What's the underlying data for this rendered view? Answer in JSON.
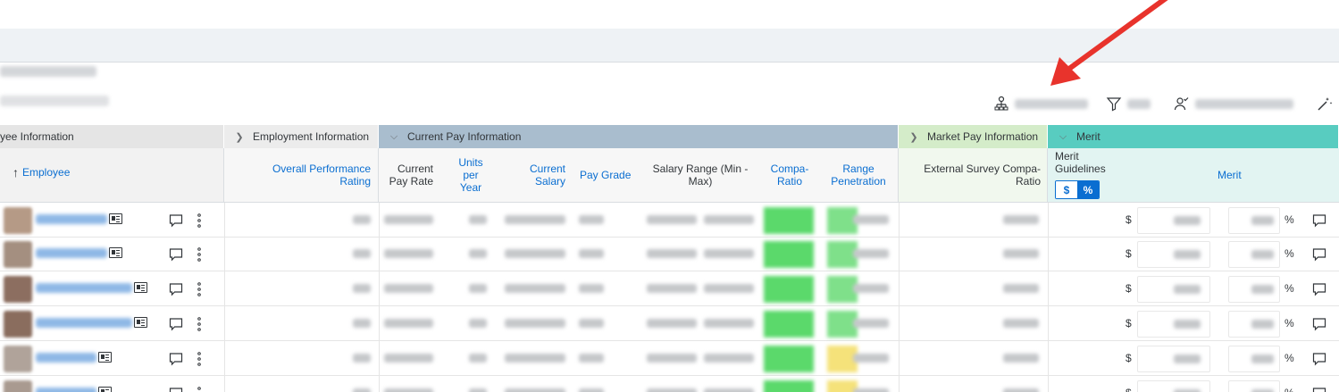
{
  "toolbar": {
    "items": [
      {
        "icon": "hierarchy-icon"
      },
      {
        "icon": "filter-icon"
      },
      {
        "icon": "user-check-icon"
      },
      {
        "icon": "magic-wand-icon"
      }
    ]
  },
  "groups": {
    "employee": "yee Information",
    "employment": "Employment Information",
    "current_pay": "Current Pay Information",
    "market_pay": "Market Pay Information",
    "merit": "Merit"
  },
  "columns": {
    "employee": "Employee",
    "overall_rating_1": "Overall Performance",
    "overall_rating_2": "Rating",
    "current_pay_rate_1": "Current",
    "current_pay_rate_2": "Pay Rate",
    "units_per_year_1": "Units",
    "units_per_year_2": "per",
    "units_per_year_3": "Year",
    "current_salary_1": "Current",
    "current_salary_2": "Salary",
    "pay_grade": "Pay Grade",
    "salary_range_1": "Salary Range (Min -",
    "salary_range_2": "Max)",
    "compa_ratio_1": "Compa-",
    "compa_ratio_2": "Ratio",
    "range_penetration_1": "Range",
    "range_penetration_2": "Penetration",
    "ext_survey_1": "External Survey Compa-",
    "ext_survey_2": "Ratio",
    "merit_guidelines_1": "Merit",
    "merit_guidelines_2": "Guidelines",
    "merit": "Merit",
    "toggle_dollar": "$",
    "toggle_percent": "%"
  },
  "rows": [
    {
      "currency": "$",
      "percent": "%",
      "penetration_color": "#7fe08a"
    },
    {
      "currency": "$",
      "percent": "%",
      "penetration_color": "#7fe08a"
    },
    {
      "currency": "$",
      "percent": "%",
      "penetration_color": "#7fe08a"
    },
    {
      "currency": "$",
      "percent": "%",
      "penetration_color": "#7fe08a"
    },
    {
      "currency": "$",
      "percent": "%",
      "penetration_color": "#f5e27a"
    },
    {
      "currency": "$",
      "percent": "%",
      "penetration_color": "#f5e27a"
    }
  ],
  "colors": {
    "compa_green": "#5bd96b",
    "merit_group": "#58ccc0",
    "pay_group": "#a9bdce",
    "market_group": "#d4ecc9",
    "arrow": "#e8332c"
  }
}
